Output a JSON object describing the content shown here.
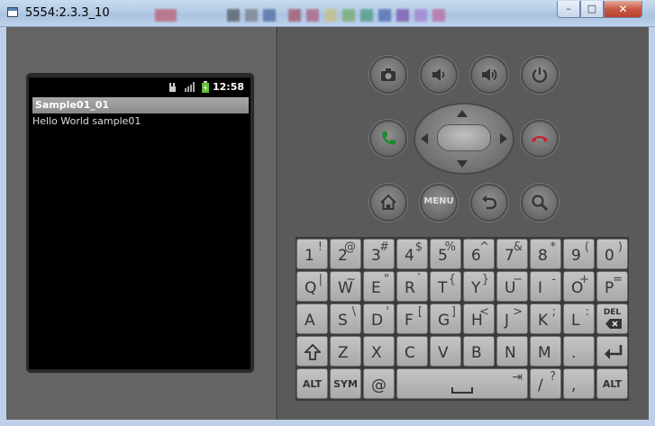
{
  "window": {
    "title": "5554:2.3.3_10",
    "controls": {
      "minimize": "–",
      "maximize": "□",
      "close": "✕"
    }
  },
  "phone": {
    "status_bar": {
      "time": "12:58"
    },
    "app": {
      "title": "Sample01_01",
      "content": "Hello World sample01"
    }
  },
  "hardware_buttons": {
    "menu_label": "MENU"
  },
  "keyboard": {
    "rows": [
      [
        {
          "main": "1",
          "alt": "!"
        },
        {
          "main": "2",
          "alt": "@"
        },
        {
          "main": "3",
          "alt": "#"
        },
        {
          "main": "4",
          "alt": "$"
        },
        {
          "main": "5",
          "alt": "%"
        },
        {
          "main": "6",
          "alt": "^"
        },
        {
          "main": "7",
          "alt": "&"
        },
        {
          "main": "8",
          "alt": "*"
        },
        {
          "main": "9",
          "alt": "("
        },
        {
          "main": "0",
          "alt": ")"
        }
      ],
      [
        {
          "main": "Q",
          "alt": "|"
        },
        {
          "main": "W",
          "alt": "~"
        },
        {
          "main": "E",
          "alt": "\""
        },
        {
          "main": "R",
          "alt": "`"
        },
        {
          "main": "T",
          "alt": "{"
        },
        {
          "main": "Y",
          "alt": "}"
        },
        {
          "main": "U",
          "alt": "−"
        },
        {
          "main": "I",
          "alt": "-"
        },
        {
          "main": "O",
          "alt": "+"
        },
        {
          "main": "P",
          "alt": "="
        }
      ],
      [
        {
          "main": "A",
          "alt": ""
        },
        {
          "main": "S",
          "alt": "\\"
        },
        {
          "main": "D",
          "alt": "'"
        },
        {
          "main": "F",
          "alt": "["
        },
        {
          "main": "G",
          "alt": "]"
        },
        {
          "main": "H",
          "alt": "<"
        },
        {
          "main": "J",
          "alt": ">"
        },
        {
          "main": "K",
          "alt": ";"
        },
        {
          "main": "L",
          "alt": ":"
        },
        {
          "main": "DEL",
          "alt": ""
        }
      ],
      [
        {
          "main": "⇧",
          "alt": ""
        },
        {
          "main": "Z",
          "alt": ""
        },
        {
          "main": "X",
          "alt": ""
        },
        {
          "main": "C",
          "alt": ""
        },
        {
          "main": "V",
          "alt": ""
        },
        {
          "main": "B",
          "alt": ""
        },
        {
          "main": "N",
          "alt": ""
        },
        {
          "main": "M",
          "alt": ""
        },
        {
          "main": ".",
          "alt": ""
        },
        {
          "main": "↵",
          "alt": ""
        }
      ]
    ],
    "bottom_row": {
      "alt_left": "ALT",
      "sym": "SYM",
      "at": "@",
      "space_alt": "⇥",
      "slash": "/",
      "slash_alt": "?",
      "comma": ",",
      "alt_right": "ALT"
    }
  },
  "colors": {
    "call_green": "#1a8a2a",
    "endcall_red": "#c8202a",
    "body": "#5a5a5a"
  }
}
